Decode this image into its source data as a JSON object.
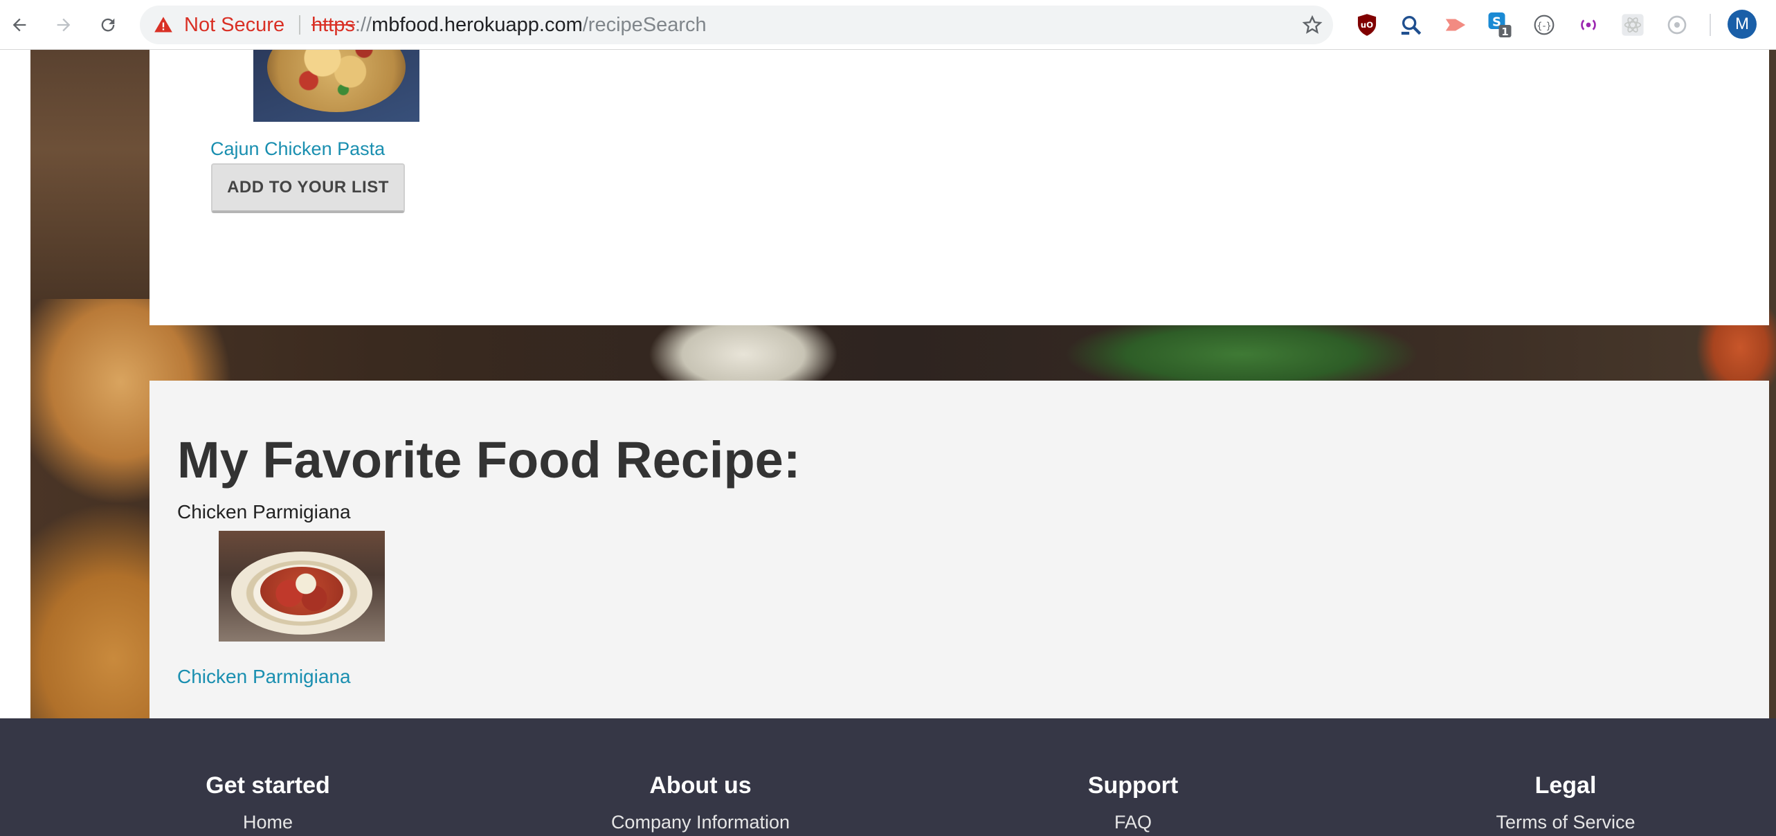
{
  "browser": {
    "security_label": "Not Secure",
    "url_scheme": "https",
    "url_separator": "://",
    "url_host": "mbfood.herokuapp.com",
    "url_path": "/recipeSearch",
    "profile_initial": "M",
    "extension_badge_count": "1",
    "extensions": [
      "ublock-origin-icon",
      "search-magnifier-icon",
      "send-arrow-icon",
      "skype-icon",
      "json-viewer-icon",
      "broadcast-icon",
      "react-devtools-icon",
      "refresh-extension-icon"
    ]
  },
  "search_results": {
    "items": [
      {
        "title": "Cajun Chicken Pasta",
        "add_button_label": "ADD TO YOUR LIST"
      }
    ]
  },
  "favorite": {
    "heading": "My Favorite Food Recipe:",
    "recipe_name": "Chicken Parmigiana",
    "recipe_link": "Chicken Parmigiana"
  },
  "footer": {
    "columns": [
      {
        "title": "Get started",
        "first_link": "Home"
      },
      {
        "title": "About us",
        "first_link": "Company Information"
      },
      {
        "title": "Support",
        "first_link": "FAQ"
      },
      {
        "title": "Legal",
        "first_link": "Terms of Service"
      }
    ]
  },
  "colors": {
    "link": "#1a8fb0",
    "footer_bg": "#363746",
    "favorite_panel_bg": "#f4f4f4",
    "insecure_red": "#d93025"
  }
}
